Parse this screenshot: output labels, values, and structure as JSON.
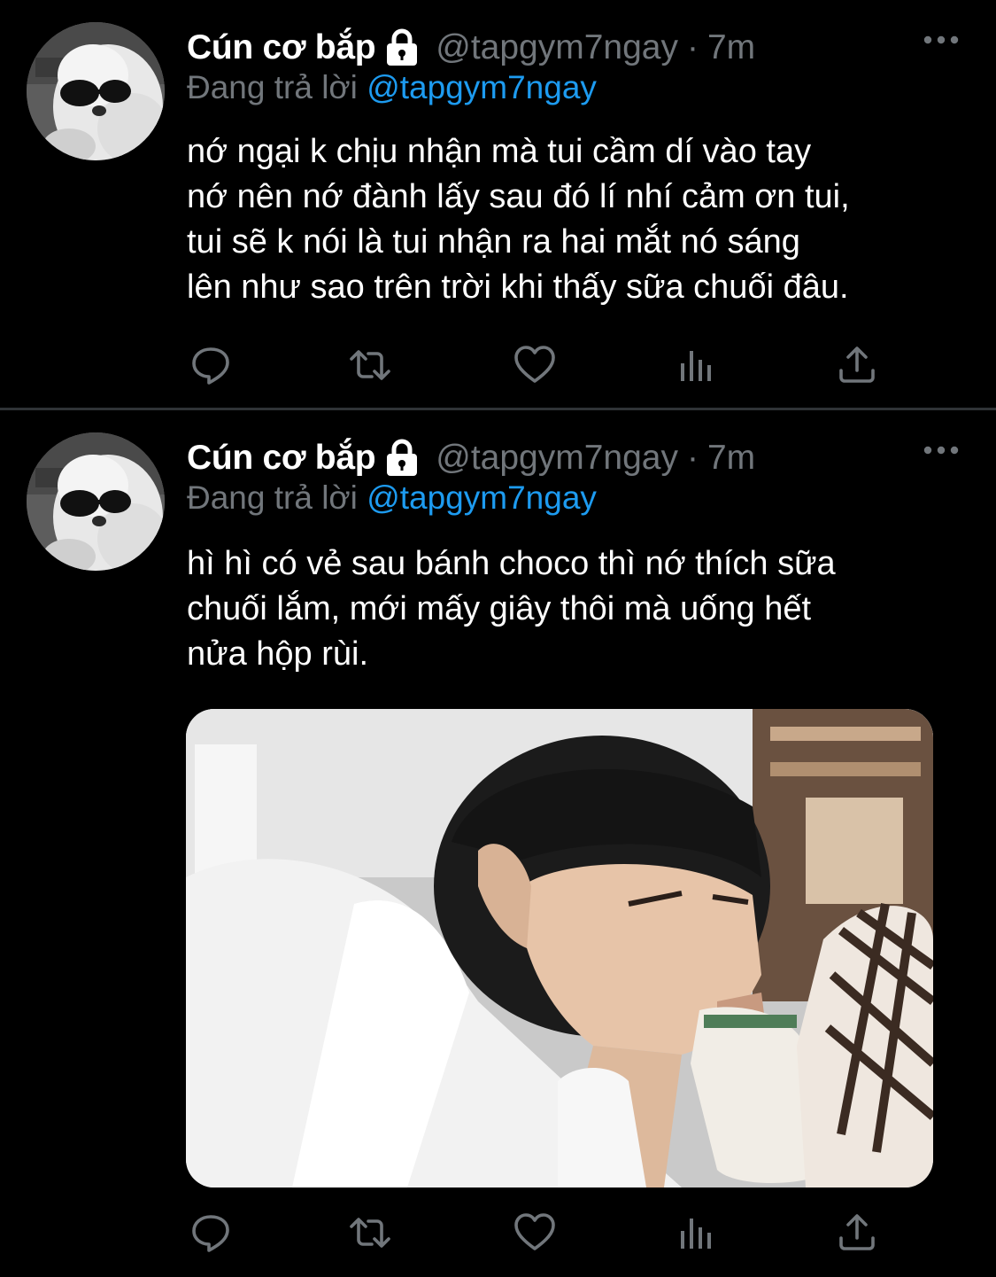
{
  "colors": {
    "background": "#000000",
    "primary_text": "#ffffff",
    "secondary_text": "#71767b",
    "link": "#1d9bf0",
    "divider": "#2f3336"
  },
  "tweets": [
    {
      "display_name": "Cún cơ bắp",
      "protected_icon": "lock-icon",
      "handle": "@tapgym7ngay",
      "separator": "·",
      "time": "7m",
      "more_icon": "more-horizontal-icon",
      "reply_prefix": "Đang trả lời",
      "reply_to": "@tapgym7ngay",
      "text": "nớ ngại k chịu nhận mà tui cầm dí vào tay\nnớ nên nớ đành lấy sau đó lí nhí cảm ơn tui,\ntui sẽ k nói là tui nhận ra hai mắt nó sáng\nlên như sao trên trời khi thấy sữa chuối đâu.",
      "actions": [
        "reply-icon",
        "retweet-icon",
        "like-icon",
        "analytics-icon",
        "share-icon"
      ]
    },
    {
      "display_name": "Cún cơ bắp",
      "protected_icon": "lock-icon",
      "handle": "@tapgym7ngay",
      "separator": "·",
      "time": "7m",
      "more_icon": "more-horizontal-icon",
      "reply_prefix": "Đang trả lời",
      "reply_to": "@tapgym7ngay",
      "text": "hì hì có vẻ sau bánh choco thì nớ thích sữa\nchuối lắm, mới mấy giây thôi mà uống hết\nnửa hộp rùi.",
      "has_media": true,
      "actions": [
        "reply-icon",
        "retweet-icon",
        "like-icon",
        "analytics-icon",
        "share-icon"
      ]
    }
  ]
}
